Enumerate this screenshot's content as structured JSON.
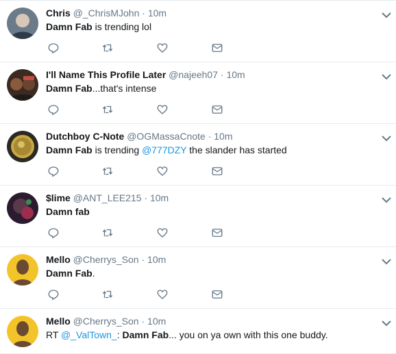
{
  "tweets": [
    {
      "fullname": "Chris",
      "username": "@_ChrisMJohn",
      "time": "10m",
      "text": {
        "strong": "Damn Fab",
        "rest": " is trending lol"
      },
      "avatar_colors": [
        "#6b7b8a",
        "#d8c7b6"
      ]
    },
    {
      "fullname": "I'll Name This Profile Later",
      "username": "@najeeh07",
      "time": "10m",
      "text": {
        "strong": "Damn Fab",
        "rest": "...that's intense"
      },
      "avatar_colors": [
        "#3a2a22",
        "#c24d3e"
      ]
    },
    {
      "fullname": "Dutchboy C-Note",
      "username": "@OGMassaCnote",
      "time": "10m",
      "text": {
        "strong": "Damn Fab",
        "rest": " is trending ",
        "link": "@777DZY",
        "after": " the slander has started"
      },
      "avatar_colors": [
        "#2b2a22",
        "#c9a847"
      ]
    },
    {
      "fullname": "$lime",
      "username": "@ANT_LEE215",
      "time": "10m",
      "text": {
        "strong": "Damn fab",
        "rest": ""
      },
      "avatar_colors": [
        "#2b1b2e",
        "#9c2d4f"
      ]
    },
    {
      "fullname": "Mello",
      "username": "@Cherrys_Son",
      "time": "10m",
      "text": {
        "strong": "Damn Fab",
        "rest": "."
      },
      "avatar_colors": [
        "#f3c42a",
        "#6b4a32"
      ]
    },
    {
      "fullname": "Mello",
      "username": "@Cherrys_Son",
      "time": "10m",
      "text": {
        "prefix": "RT ",
        "link": "@_ValTown_",
        "after_link": ": ",
        "strong": "Damn Fab",
        "rest": "... you on ya own with this one buddy."
      },
      "avatar_colors": [
        "#f3c42a",
        "#6b4a32"
      ]
    }
  ],
  "header_separator": "·",
  "icons": [
    "reply-icon",
    "retweet-icon",
    "like-icon",
    "direct-message-icon",
    "chevron-down-icon"
  ],
  "colors": {
    "link": "#1b95e0",
    "muted": "#657786",
    "icon": "#657786",
    "divider": "#e6ecf0"
  }
}
